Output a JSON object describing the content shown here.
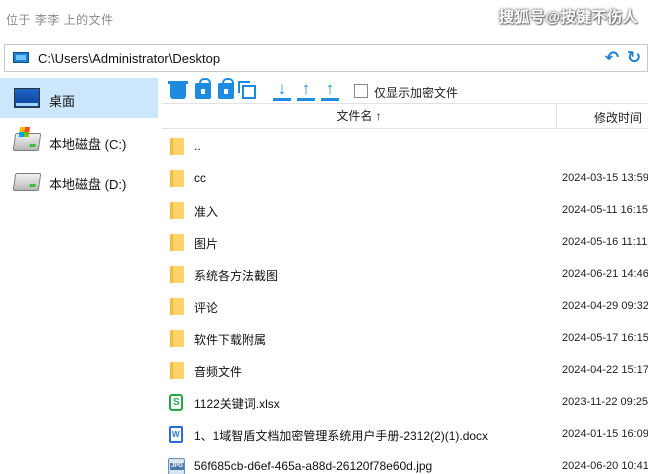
{
  "window": {
    "title": "位于 李李 上的文件",
    "watermark": "搜狐号@按键不伤人"
  },
  "address": {
    "path": "C:\\Users\\Administrator\\Desktop"
  },
  "sidebar": {
    "items": [
      {
        "label": "桌面",
        "icon": "desktop-icon",
        "active": true
      },
      {
        "label": "本地磁盘 (C:)",
        "icon": "system-drive-icon",
        "active": false
      },
      {
        "label": "本地磁盘 (D:)",
        "icon": "drive-icon",
        "active": false
      }
    ]
  },
  "toolbar": {
    "show_encrypted_label": "仅显示加密文件"
  },
  "columns": {
    "name": "文件名 ↑",
    "modified": "修改时间"
  },
  "files": [
    {
      "name": "..",
      "time": "",
      "icon": "folder-icon"
    },
    {
      "name": "cc",
      "time": "2024-03-15 13:59",
      "icon": "folder-icon"
    },
    {
      "name": "准入",
      "time": "2024-05-11 16:15",
      "icon": "folder-icon"
    },
    {
      "name": "图片",
      "time": "2024-05-16 11:11",
      "icon": "folder-icon"
    },
    {
      "name": "系统各方法截图",
      "time": "2024-06-21 14:46",
      "icon": "folder-icon"
    },
    {
      "name": "评论",
      "time": "2024-04-29 09:32",
      "icon": "folder-icon"
    },
    {
      "name": "软件下载附属",
      "time": "2024-05-17 16:15",
      "icon": "folder-icon"
    },
    {
      "name": "音频文件",
      "time": "2024-04-22 15:17",
      "icon": "folder-icon"
    },
    {
      "name": "1122关键词.xlsx",
      "time": "2023-11-22 09:25",
      "icon": "xlsx-icon"
    },
    {
      "name": "1、1域智盾文档加密管理系统用户手册-2312(2)(1).docx",
      "time": "2024-01-15 16:09",
      "icon": "docx-icon"
    },
    {
      "name": "56f685cb-d6ef-465a-a88d-26120f78e60d.jpg",
      "time": "2024-06-20 10:41",
      "icon": "jpg-icon"
    }
  ],
  "colors": {
    "accent": "#1d8be0",
    "selected_bg": "#cce6fb",
    "folder": "#fcd46a"
  }
}
